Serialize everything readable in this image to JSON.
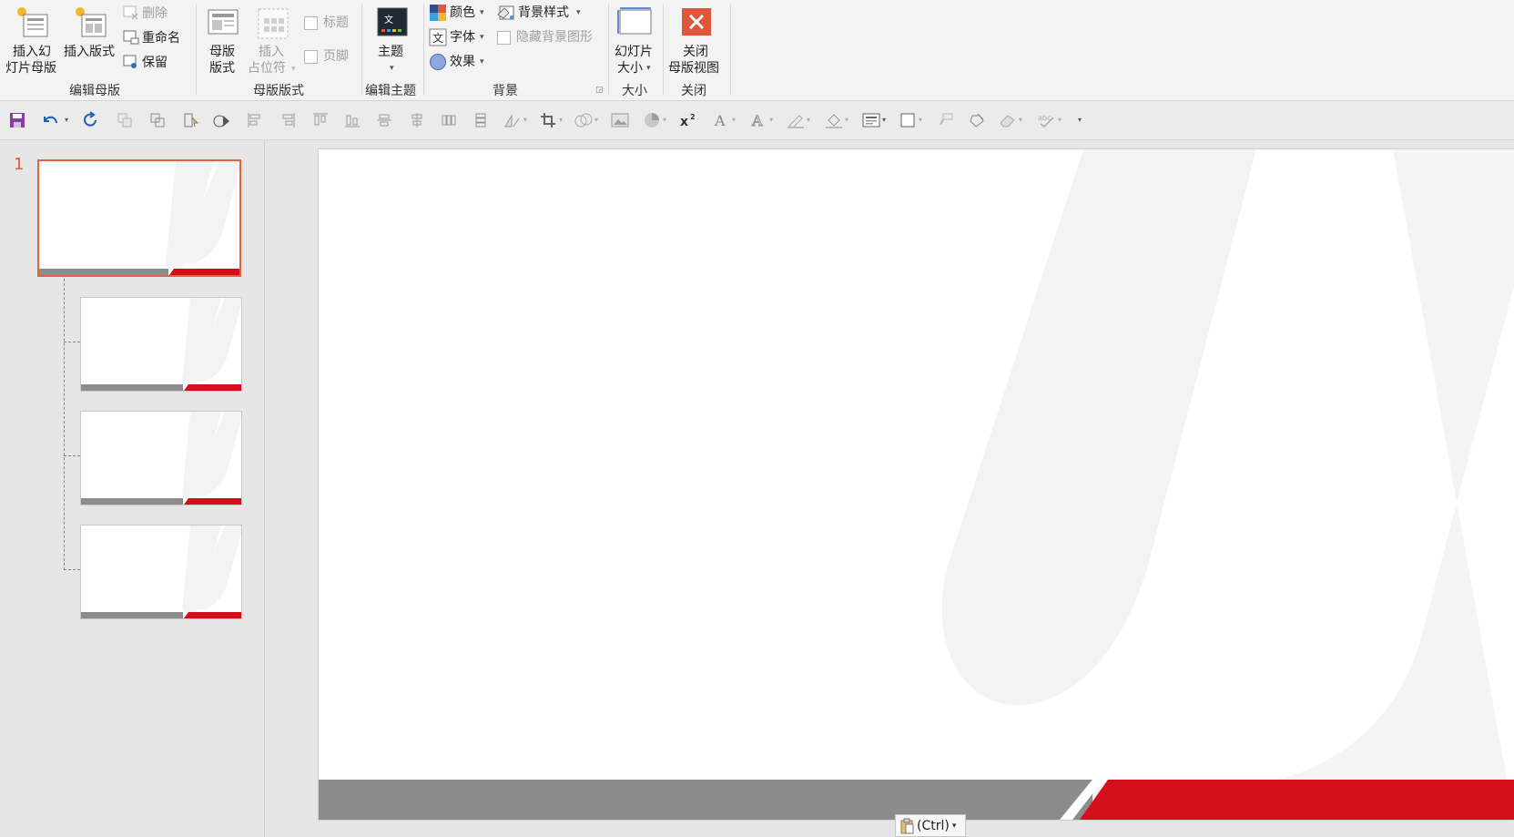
{
  "ribbon": {
    "groups": {
      "edit_master": {
        "label": "编辑母版",
        "insert_master_line1": "插入幻",
        "insert_master_line2": "灯片母版",
        "insert_layout": "插入版式",
        "delete": "删除",
        "rename": "重命名",
        "preserve": "保留"
      },
      "master_layout": {
        "label": "母版版式",
        "master_layout_line1": "母版",
        "master_layout_line2": "版式",
        "insert_placeholder_line1": "插入",
        "insert_placeholder_line2": "占位符",
        "title_checkbox": "标题",
        "footer_checkbox": "页脚"
      },
      "edit_theme": {
        "label": "编辑主题",
        "theme": "主题"
      },
      "background": {
        "label": "背景",
        "colors": "颜色",
        "fonts": "字体",
        "effects": "效果",
        "bg_styles": "背景样式",
        "hide_bg_graphics": "隐藏背景图形"
      },
      "size": {
        "label": "大小",
        "slide_size_line1": "幻灯片",
        "slide_size_line2": "大小"
      },
      "close": {
        "label": "关闭",
        "close_line1": "关闭",
        "close_line2": "母版视图"
      }
    }
  },
  "thumbnails": {
    "master_number": "1"
  },
  "paste_options": {
    "label": "(Ctrl)"
  },
  "colors": {
    "accent_red": "#d30f1b",
    "footer_gray": "#8c8c8c",
    "selection_orange": "#e8613f",
    "close_button": "#e0563a"
  }
}
